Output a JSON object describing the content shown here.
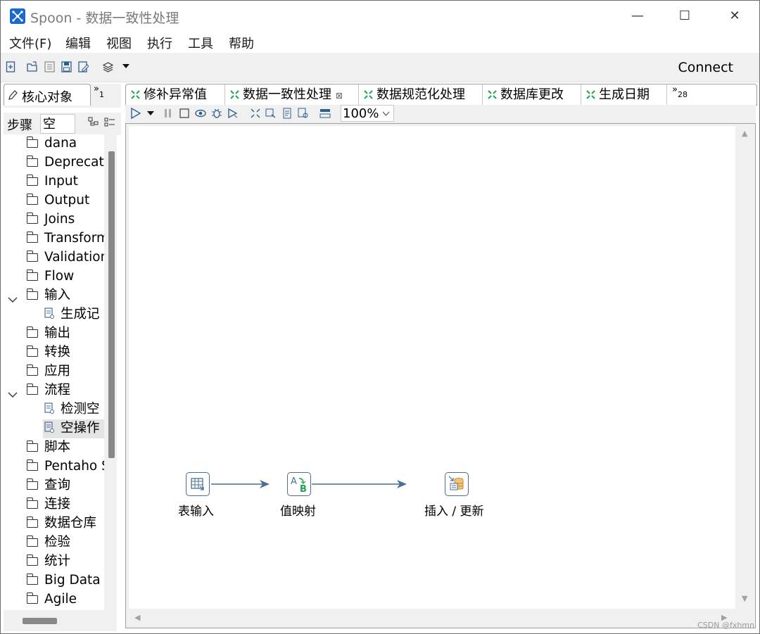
{
  "window": {
    "title": "Spoon - 数据一致性处理",
    "minimize_glyph": "—",
    "maximize_glyph": "☐",
    "close_glyph": "✕"
  },
  "menu": [
    "文件(F)",
    "编辑",
    "视图",
    "执行",
    "工具",
    "帮助"
  ],
  "toolbar": {
    "connect_label": "Connect"
  },
  "left_panel": {
    "tab_label": "核心对象",
    "tab_overflow": "1",
    "steps_label": "步骤",
    "search_value": "空",
    "tree": [
      {
        "label": "dana",
        "type": "folder",
        "level": 0
      },
      {
        "label": "Deprecate",
        "type": "folder",
        "level": 0
      },
      {
        "label": "Input",
        "type": "folder",
        "level": 0
      },
      {
        "label": "Output",
        "type": "folder",
        "level": 0
      },
      {
        "label": "Joins",
        "type": "folder",
        "level": 0
      },
      {
        "label": "Transform",
        "type": "folder",
        "level": 0
      },
      {
        "label": "Validation",
        "type": "folder",
        "level": 0
      },
      {
        "label": "Flow",
        "type": "folder",
        "level": 0
      },
      {
        "label": "输入",
        "type": "folder",
        "level": 0,
        "expanded": true
      },
      {
        "label": "生成记",
        "type": "step",
        "level": 1
      },
      {
        "label": "输出",
        "type": "folder",
        "level": 0
      },
      {
        "label": "转换",
        "type": "folder",
        "level": 0
      },
      {
        "label": "应用",
        "type": "folder",
        "level": 0
      },
      {
        "label": "流程",
        "type": "folder",
        "level": 0,
        "expanded": true
      },
      {
        "label": "检测空",
        "type": "step",
        "level": 1
      },
      {
        "label": "空操作",
        "type": "step",
        "level": 1,
        "selected": true
      },
      {
        "label": "脚本",
        "type": "folder",
        "level": 0
      },
      {
        "label": "Pentaho S",
        "type": "folder",
        "level": 0
      },
      {
        "label": "查询",
        "type": "folder",
        "level": 0
      },
      {
        "label": "连接",
        "type": "folder",
        "level": 0
      },
      {
        "label": "数据仓库",
        "type": "folder",
        "level": 0
      },
      {
        "label": "检验",
        "type": "folder",
        "level": 0
      },
      {
        "label": "统计",
        "type": "folder",
        "level": 0
      },
      {
        "label": "Big Data",
        "type": "folder",
        "level": 0
      },
      {
        "label": "Agile",
        "type": "folder",
        "level": 0
      }
    ]
  },
  "editor": {
    "tabs": [
      {
        "label": "修补异常值",
        "active": false
      },
      {
        "label": "数据一致性处理",
        "active": true,
        "closable": true
      },
      {
        "label": "数据规范化处理",
        "active": false
      },
      {
        "label": "数据库更改",
        "active": false
      },
      {
        "label": "生成日期",
        "active": false
      }
    ],
    "tab_overflow": "28",
    "zoom": "100%",
    "nodes": [
      {
        "label": "表输入",
        "icon": "table-input-icon"
      },
      {
        "label": "值映射",
        "icon": "value-mapper-icon"
      },
      {
        "label": "插入 / 更新",
        "icon": "insert-update-icon"
      }
    ]
  },
  "watermark": "CSDN @fxhmn"
}
